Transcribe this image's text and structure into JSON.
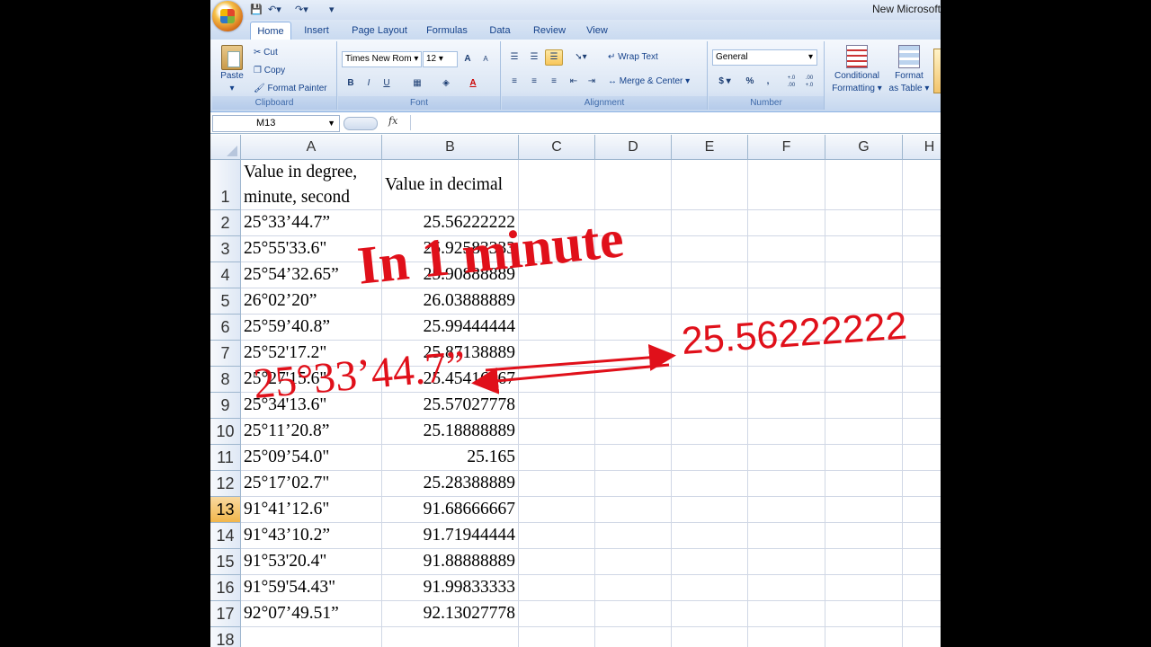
{
  "title_bar": {
    "title": "New Microsoft"
  },
  "tabs": [
    "Home",
    "Insert",
    "Page Layout",
    "Formulas",
    "Data",
    "Review",
    "View"
  ],
  "ribbon": {
    "clipboard": {
      "label": "Clipboard",
      "paste": "Paste",
      "cut": "Cut",
      "copy": "Copy",
      "format_painter": "Format Painter"
    },
    "font": {
      "label": "Font",
      "font_name": "Times New Rom",
      "font_size": "12",
      "bold": "B",
      "italic": "I",
      "underline": "U",
      "grow": "A",
      "shrink": "A",
      "font_color": "A"
    },
    "alignment": {
      "label": "Alignment",
      "wrap_text": "Wrap Text",
      "merge_center": "Merge & Center"
    },
    "number": {
      "label": "Number",
      "format": "General",
      "currency": "$",
      "percent": "%",
      "comma": ",",
      "inc_decimal": "+.0 .00",
      "dec_decimal": ".00 +.0"
    },
    "styles": {
      "conditional_formatting_line1": "Conditional",
      "conditional_formatting_line2": "Formatting",
      "format_as_table_line1": "Format",
      "format_as_table_line2": "as Table"
    }
  },
  "formula_bar": {
    "name_box": "M13",
    "fx": "fx",
    "formula": ""
  },
  "columns": [
    "A",
    "B",
    "C",
    "D",
    "E",
    "F",
    "G",
    "H"
  ],
  "selected_row": "13",
  "rows": [
    {
      "n": "1",
      "a1": "Value in degree,",
      "a2": "minute, second",
      "b": "Value in decimal"
    },
    {
      "n": "2",
      "a": "25°33’44.7”",
      "b": "25.56222222"
    },
    {
      "n": "3",
      "a": "25°55'33.6\"",
      "b": "25.92583333"
    },
    {
      "n": "4",
      "a": "25°54’32.65”",
      "b": "25.90888889"
    },
    {
      "n": "5",
      "a": "26°02’20”",
      "b": "26.03888889"
    },
    {
      "n": "6",
      "a": "25°59’40.8”",
      "b": "25.99444444"
    },
    {
      "n": "7",
      "a": "25°52'17.2\"",
      "b": "25.87138889"
    },
    {
      "n": "8",
      "a": "25°27'15.6\"",
      "b": "25.45416667"
    },
    {
      "n": "9",
      "a": "25°34'13.6\"",
      "b": "25.57027778"
    },
    {
      "n": "10",
      "a": "25°11’20.8”",
      "b": "25.18888889"
    },
    {
      "n": "11",
      "a": "25°09’54.0\"",
      "b": "25.165"
    },
    {
      "n": "12",
      "a": "25°17’02.7\"",
      "b": "25.28388889"
    },
    {
      "n": "13",
      "a": "91°41’12.6\"",
      "b": "91.68666667"
    },
    {
      "n": "14",
      "a": "91°43’10.2”",
      "b": "91.71944444"
    },
    {
      "n": "15",
      "a": "91°53'20.4\"",
      "b": "91.88888889"
    },
    {
      "n": "16",
      "a": "91°59'54.43\"",
      "b": "91.99833333"
    },
    {
      "n": "17",
      "a": "92°07’49.51”",
      "b": "92.13027778"
    },
    {
      "n": "18",
      "a": "",
      "b": ""
    }
  ],
  "annotations": {
    "headline": "In 1 minute",
    "dms": "25°33’44.7”",
    "decimal": "25.56222222",
    "color": "#e0101a"
  }
}
